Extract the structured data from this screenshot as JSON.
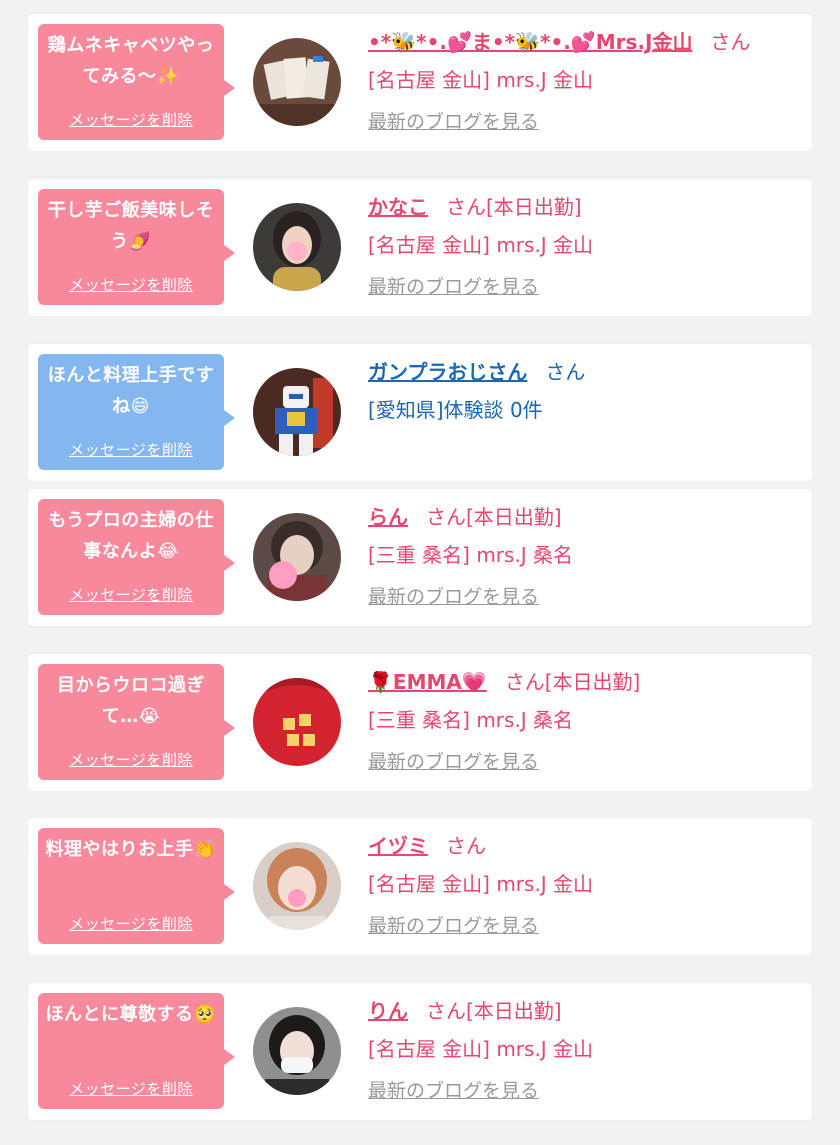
{
  "colors": {
    "pink_bubble": "#f8899c",
    "blue_bubble": "#84b6f0",
    "pink_text": "#e8466e",
    "blue_text": "#1a67b4",
    "link_gray": "#999999"
  },
  "cards": [
    {
      "message": "鶏ムネキャベツやってみる〜✨",
      "delete_label": "メッセージを削除",
      "name": "•*🐝*•.💕ま•*🐝*•.💕Mrs.J金山",
      "suffix": "さん",
      "shop": "[名古屋 金山] mrs.J 金山",
      "blog_link": "最新のブログを見る",
      "bubble_color": "pink",
      "avatar_icon": "documents-photo-avatar"
    },
    {
      "message": "干し芋ご飯美味しそう🍠",
      "delete_label": "メッセージを削除",
      "name": "かなこ",
      "suffix": "さん[本日出勤]",
      "shop": "[名古屋 金山] mrs.J 金山",
      "blog_link": "最新のブログを見る",
      "bubble_color": "pink",
      "avatar_icon": "woman-photo-avatar"
    },
    {
      "message": "ほんと料理上手ですね😄",
      "delete_label": "メッセージを削除",
      "name": "ガンプラおじさん",
      "suffix": "さん",
      "shop": "[愛知県]体験談 0件",
      "blog_link": "",
      "bubble_color": "blue",
      "avatar_icon": "robot-model-avatar"
    },
    {
      "message": "もうプロの主婦の仕事なんよ😂",
      "delete_label": "メッセージを削除",
      "name": "らん",
      "suffix": "さん[本日出勤]",
      "shop": "[三重 桑名] mrs.J 桑名",
      "blog_link": "最新のブログを見る",
      "bubble_color": "pink",
      "avatar_icon": "blurred-woman-avatar"
    },
    {
      "message": "目からウロコ過ぎて…😭",
      "delete_label": "メッセージを削除",
      "name": "🌹EMMA💗",
      "suffix": "さん[本日出勤]",
      "shop": "[三重 桑名] mrs.J 桑名",
      "blog_link": "最新のブログを見る",
      "bubble_color": "pink",
      "avatar_icon": "red-hoodie-avatar"
    },
    {
      "message": "料理やはりお上手👏",
      "delete_label": "メッセージを削除",
      "name": "イヅミ",
      "suffix": "さん",
      "shop": "[名古屋 金山] mrs.J 金山",
      "blog_link": "最新のブログを見る",
      "bubble_color": "pink",
      "avatar_icon": "woman-photo-avatar"
    },
    {
      "message": "ほんとに尊敬する🥺",
      "delete_label": "メッセージを削除",
      "name": "りん",
      "suffix": "さん[本日出勤]",
      "shop": "[名古屋 金山] mrs.J 金山",
      "blog_link": "最新のブログを見る",
      "bubble_color": "pink",
      "avatar_icon": "masked-woman-avatar"
    }
  ]
}
